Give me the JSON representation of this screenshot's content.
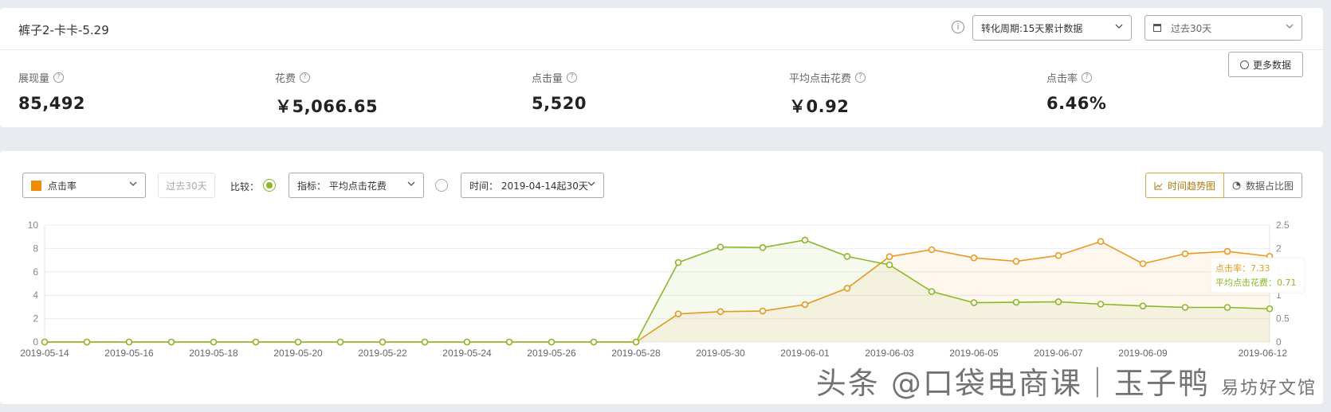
{
  "header": {
    "title": "裤子2-卡卡-5.29",
    "info_icon": "i",
    "conversion_select": "转化周期:15天累计数据",
    "range_select": "过去30天",
    "more_button": "更多数据"
  },
  "metrics": [
    {
      "label": "展现量",
      "value": "85,492"
    },
    {
      "label": "花费",
      "value": "￥5,066.65"
    },
    {
      "label": "点击量",
      "value": "5,520"
    },
    {
      "label": "平均点击花费",
      "value": "￥0.92"
    },
    {
      "label": "点击率",
      "value": "6.46%"
    }
  ],
  "toolbar": {
    "metric_select": "点击率",
    "last30_button": "过去30天",
    "compare_label": "比较：",
    "indicator_select": "指标：  平均点击花费",
    "time_select": "时间：  2019-04-14起30天",
    "trend_button": "时间趋势图",
    "share_button": "数据占比图"
  },
  "colors": {
    "orange": "#ea9a22",
    "green": "#8ab828",
    "accent": "#f08c00"
  },
  "chart_data": {
    "type": "line",
    "x": [
      "2019-05-14",
      "2019-05-15",
      "2019-05-16",
      "2019-05-17",
      "2019-05-18",
      "2019-05-19",
      "2019-05-20",
      "2019-05-21",
      "2019-05-22",
      "2019-05-23",
      "2019-05-24",
      "2019-05-25",
      "2019-05-26",
      "2019-05-27",
      "2019-05-28",
      "2019-05-29",
      "2019-05-30",
      "2019-05-31",
      "2019-06-01",
      "2019-06-02",
      "2019-06-03",
      "2019-06-04",
      "2019-06-05",
      "2019-06-06",
      "2019-06-07",
      "2019-06-08",
      "2019-06-09",
      "2019-06-10",
      "2019-06-11",
      "2019-06-12"
    ],
    "x_tick_labels": [
      "2019-05-14",
      "2019-05-16",
      "2019-05-18",
      "2019-05-20",
      "2019-05-22",
      "2019-05-24",
      "2019-05-26",
      "2019-05-28",
      "2019-05-30",
      "2019-06-01",
      "2019-06-03",
      "2019-06-05",
      "2019-06-07",
      "2019-06-09",
      "2019-06-12"
    ],
    "series": [
      {
        "name": "点击率",
        "axis": "left",
        "color": "#ea9a22",
        "values": [
          0,
          0,
          0,
          0,
          0,
          0,
          0,
          0,
          0,
          0,
          0,
          0,
          0,
          0,
          0,
          2.4,
          2.6,
          2.65,
          3.2,
          4.6,
          7.3,
          7.9,
          7.2,
          6.9,
          7.4,
          8.6,
          6.7,
          7.55,
          7.75,
          7.33
        ]
      },
      {
        "name": "平均点击花费",
        "axis": "right",
        "color": "#8ab828",
        "values": [
          0,
          0,
          0,
          0,
          0,
          0,
          0,
          0,
          0,
          0,
          0,
          0,
          0,
          0,
          0,
          1.7,
          2.03,
          2.02,
          2.18,
          1.83,
          1.65,
          1.08,
          0.84,
          0.85,
          0.86,
          0.81,
          0.77,
          0.74,
          0.74,
          0.71
        ]
      }
    ],
    "y_left": {
      "min": 0,
      "max": 10,
      "ticks": [
        "0",
        "2",
        "4",
        "6",
        "8",
        "10"
      ]
    },
    "y_right": {
      "min": 0,
      "max": 2.5,
      "ticks": [
        "0",
        "0.5",
        "1",
        "1.5",
        "2",
        "2.5"
      ]
    },
    "tooltip": {
      "line1": "点击率：7.33",
      "line2": "平均点击花费：0.71"
    },
    "grid": true
  },
  "watermark": {
    "main": "头条 @口袋电商课｜玉子鸭",
    "sub": "易坊好文馆"
  }
}
